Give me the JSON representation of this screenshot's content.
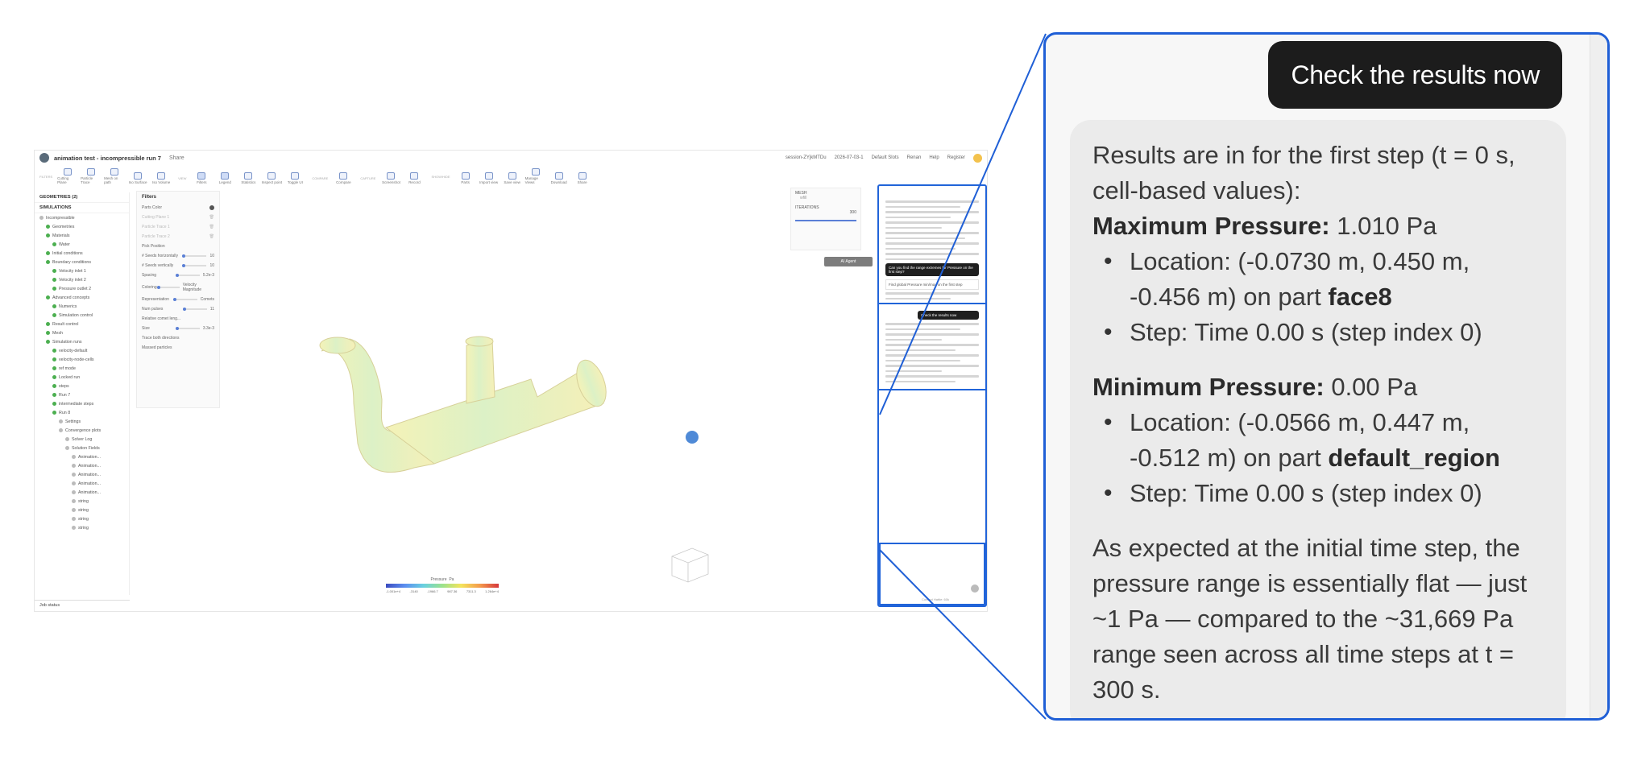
{
  "app": {
    "project_title": "animation test - incompressible run 7",
    "share_label": "Share",
    "session": "session-ZYjkMTDu",
    "date": "2026-07-03-1",
    "default_slots": "Default Slots",
    "user_short": "Renan",
    "help": "Help",
    "login": "Register"
  },
  "toolbar": {
    "groups": [
      {
        "caption": "FILTERS",
        "buttons": [
          "Cutting Plane",
          "Particle Trace",
          "Mesh on path",
          "Iso Surface",
          "Iso Volume"
        ]
      },
      {
        "caption": "VIEW",
        "buttons": [
          "Filters",
          "Legend",
          "Statistics",
          "Inspect point",
          "Toggle UI"
        ]
      },
      {
        "caption": "COMPARE",
        "buttons": [
          "Compare"
        ]
      },
      {
        "caption": "CAPTURE",
        "buttons": [
          "Screenshot",
          "Record"
        ]
      },
      {
        "caption": "SHOW/HIDE",
        "buttons": [
          "Parts",
          "Import view",
          "Save view",
          "Manage Views",
          "Download",
          "Share"
        ]
      }
    ]
  },
  "tree": {
    "geometries": "GEOMETRIES (2)",
    "simulations": "SIMULATIONS",
    "items": [
      "Incompressible",
      "Geometries",
      "Materials",
      "Water",
      "Initial conditions",
      "Boundary conditions",
      "Velocity inlet 1",
      "Velocity inlet 2",
      "Pressure outlet 2",
      "Advanced concepts",
      "Numerics",
      "Simulation control",
      "Result control",
      "Mesh",
      "Simulation runs",
      "velocity-default",
      "velocity-node-cells",
      "ref mode",
      "Locked run",
      "steps",
      "Run 7",
      "intermediate steps",
      "Run 8",
      "Settings",
      "Convergence plots",
      "Solver Log",
      "Solution Fields",
      "Animation...",
      "Animation...",
      "Animation...",
      "Animation...",
      "Animation...",
      "string",
      "string",
      "string",
      "string"
    ],
    "job_status": "Job status"
  },
  "filters": {
    "title": "Filters",
    "parts_color": "Parts Color",
    "traces": [
      "Cutting Plane 1",
      "Particle Trace 1",
      "Particle Trace 2"
    ],
    "rows": [
      {
        "label": "Pick Position",
        "value": ""
      },
      {
        "label": "# Seeds horizontally",
        "value": "10"
      },
      {
        "label": "# Seeds vertically",
        "value": "10"
      },
      {
        "label": "Spacing",
        "value": "5.2e-3"
      },
      {
        "label": "Coloring",
        "value": "Velocity Magnitude"
      },
      {
        "label": "Representation",
        "value": "Comets"
      },
      {
        "label": "Num pulses",
        "value": "11"
      },
      {
        "label": "Relative comet leng...",
        "value": ""
      },
      {
        "label": "Size",
        "value": "3.3e-3"
      },
      {
        "label": "Trace both directions",
        "value": ""
      },
      {
        "label": "Massed particles",
        "value": ""
      }
    ]
  },
  "legend": {
    "field": "Pressure",
    "unit": "Pa",
    "ticks": [
      "-1.001e+4",
      "-3140",
      "-1966.7",
      "987.36",
      "7311.3",
      "1.264e+4"
    ]
  },
  "mesh_panel": {
    "mesh": "MESH",
    "wfill": "wfill",
    "iterations": "ITERATIONS",
    "iter_value": "300"
  },
  "ai_agent_label": "AI Agent",
  "chat_mini": {
    "user_q": "Can you find the range extremes for Pressure on the first step?",
    "task": "Find global Pressure min/max on the first step",
    "user_check": "Check the results now",
    "footer": "Contact Hattie: 60k"
  },
  "zoom": {
    "user_message": "Check the results now",
    "intro": "Results are in for the first step (t = 0 s, cell-based values):",
    "max_label": "Maximum Pressure:",
    "max_value": "1.010 Pa",
    "max_location": "Location: (-0.0730 m, 0.450 m, -0.456 m) on part ",
    "max_part": "face8",
    "max_step": "Step: Time 0.00 s (step index 0)",
    "min_label": "Minimum Pressure:",
    "min_value": "0.00 Pa",
    "min_location": "Location: (-0.0566 m, 0.447 m, -0.512 m) on part ",
    "min_part": "default_region",
    "min_step": "Step: Time 0.00 s (step index 0)",
    "conclusion": "As expected at the initial time step, the pressure range is essentially flat — just ~1 Pa — compared to the ~31,669 Pa range seen across all time steps at t = 300 s."
  },
  "colors": {
    "accent": "#1f5fd6",
    "user_bubble": "#1c1c1c",
    "assistant_bubble": "#ebebeb"
  }
}
